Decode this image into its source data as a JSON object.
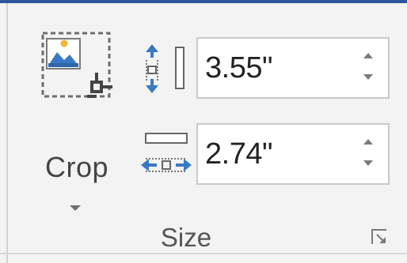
{
  "crop": {
    "label": "Crop",
    "icon": "crop-icon",
    "dropdown_icon": "chevron-down-icon"
  },
  "size": {
    "group_label": "Size",
    "height": {
      "icon": "shape-height-icon",
      "value": "3.55\""
    },
    "width": {
      "icon": "shape-width-icon",
      "value": "2.74\""
    },
    "dialog_launcher_icon": "dialog-launcher-icon"
  },
  "colors": {
    "accent": "#2b579a",
    "icon_blue": "#3a78c4",
    "icon_dark": "#666666"
  }
}
